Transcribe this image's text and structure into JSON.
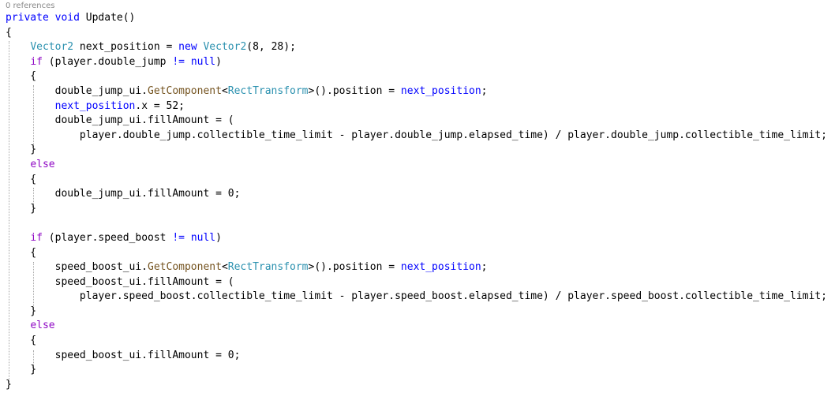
{
  "codelens": "0 references",
  "lines": [
    {
      "tokens": [
        {
          "t": "private",
          "c": "kw"
        },
        {
          "t": " "
        },
        {
          "t": "void",
          "c": "kw"
        },
        {
          "t": " Update()"
        }
      ]
    },
    {
      "tokens": [
        {
          "t": "{"
        }
      ]
    },
    {
      "tokens": [
        {
          "t": "    "
        },
        {
          "t": "Vector2",
          "c": "tp"
        },
        {
          "t": " next_position = "
        },
        {
          "t": "new",
          "c": "kw"
        },
        {
          "t": " "
        },
        {
          "t": "Vector2",
          "c": "tp"
        },
        {
          "t": "(8, 28);"
        }
      ]
    },
    {
      "tokens": [
        {
          "t": "    "
        },
        {
          "t": "if",
          "c": "ctrl"
        },
        {
          "t": " (player.double_jump "
        },
        {
          "t": "!=",
          "c": "kw"
        },
        {
          "t": " "
        },
        {
          "t": "null",
          "c": "kw"
        },
        {
          "t": ")"
        }
      ]
    },
    {
      "tokens": [
        {
          "t": "    {"
        }
      ]
    },
    {
      "tokens": [
        {
          "t": "        double_jump_ui."
        },
        {
          "t": "GetComponent",
          "c": "fn"
        },
        {
          "t": "<"
        },
        {
          "t": "RectTransform",
          "c": "tp"
        },
        {
          "t": ">().position = "
        },
        {
          "t": "next_position",
          "c": "kw"
        },
        {
          "t": ";"
        }
      ]
    },
    {
      "tokens": [
        {
          "t": "        "
        },
        {
          "t": "next_position",
          "c": "kw"
        },
        {
          "t": ".x = 52;"
        }
      ]
    },
    {
      "tokens": [
        {
          "t": "        double_jump_ui.fillAmount = ("
        }
      ]
    },
    {
      "tokens": [
        {
          "t": "            player.double_jump.collectible_time_limit - player.double_jump.elapsed_time) / player.double_jump.collectible_time_limit;"
        }
      ]
    },
    {
      "tokens": [
        {
          "t": "    }"
        }
      ]
    },
    {
      "tokens": [
        {
          "t": "    "
        },
        {
          "t": "else",
          "c": "ctrl"
        }
      ]
    },
    {
      "tokens": [
        {
          "t": "    {"
        }
      ]
    },
    {
      "tokens": [
        {
          "t": "        double_jump_ui.fillAmount = 0;"
        }
      ]
    },
    {
      "tokens": [
        {
          "t": "    }"
        }
      ]
    },
    {
      "tokens": [
        {
          "t": ""
        }
      ]
    },
    {
      "tokens": [
        {
          "t": "    "
        },
        {
          "t": "if",
          "c": "ctrl"
        },
        {
          "t": " (player.speed_boost "
        },
        {
          "t": "!=",
          "c": "kw"
        },
        {
          "t": " "
        },
        {
          "t": "null",
          "c": "kw"
        },
        {
          "t": ")"
        }
      ]
    },
    {
      "tokens": [
        {
          "t": "    {"
        }
      ]
    },
    {
      "tokens": [
        {
          "t": "        speed_boost_ui."
        },
        {
          "t": "GetComponent",
          "c": "fn"
        },
        {
          "t": "<"
        },
        {
          "t": "RectTransform",
          "c": "tp"
        },
        {
          "t": ">().position = "
        },
        {
          "t": "next_position",
          "c": "kw"
        },
        {
          "t": ";"
        }
      ]
    },
    {
      "tokens": [
        {
          "t": "        speed_boost_ui.fillAmount = ("
        }
      ]
    },
    {
      "tokens": [
        {
          "t": "            player.speed_boost.collectible_time_limit - player.speed_boost.elapsed_time) / player.speed_boost.collectible_time_limit;"
        }
      ]
    },
    {
      "tokens": [
        {
          "t": "    }"
        }
      ]
    },
    {
      "tokens": [
        {
          "t": "    "
        },
        {
          "t": "else",
          "c": "ctrl"
        }
      ]
    },
    {
      "tokens": [
        {
          "t": "    {"
        }
      ]
    },
    {
      "tokens": [
        {
          "t": "        speed_boost_ui.fillAmount = 0;"
        }
      ]
    },
    {
      "tokens": [
        {
          "t": "    }"
        }
      ]
    },
    {
      "tokens": [
        {
          "t": "}"
        }
      ]
    }
  ],
  "colors": {
    "keyword": "#0000ff",
    "type": "#2b91af",
    "method": "#74531f",
    "control": "#8f08c4",
    "plain": "#000000",
    "codelens": "#8a8a8a",
    "background": "#ffffff"
  }
}
